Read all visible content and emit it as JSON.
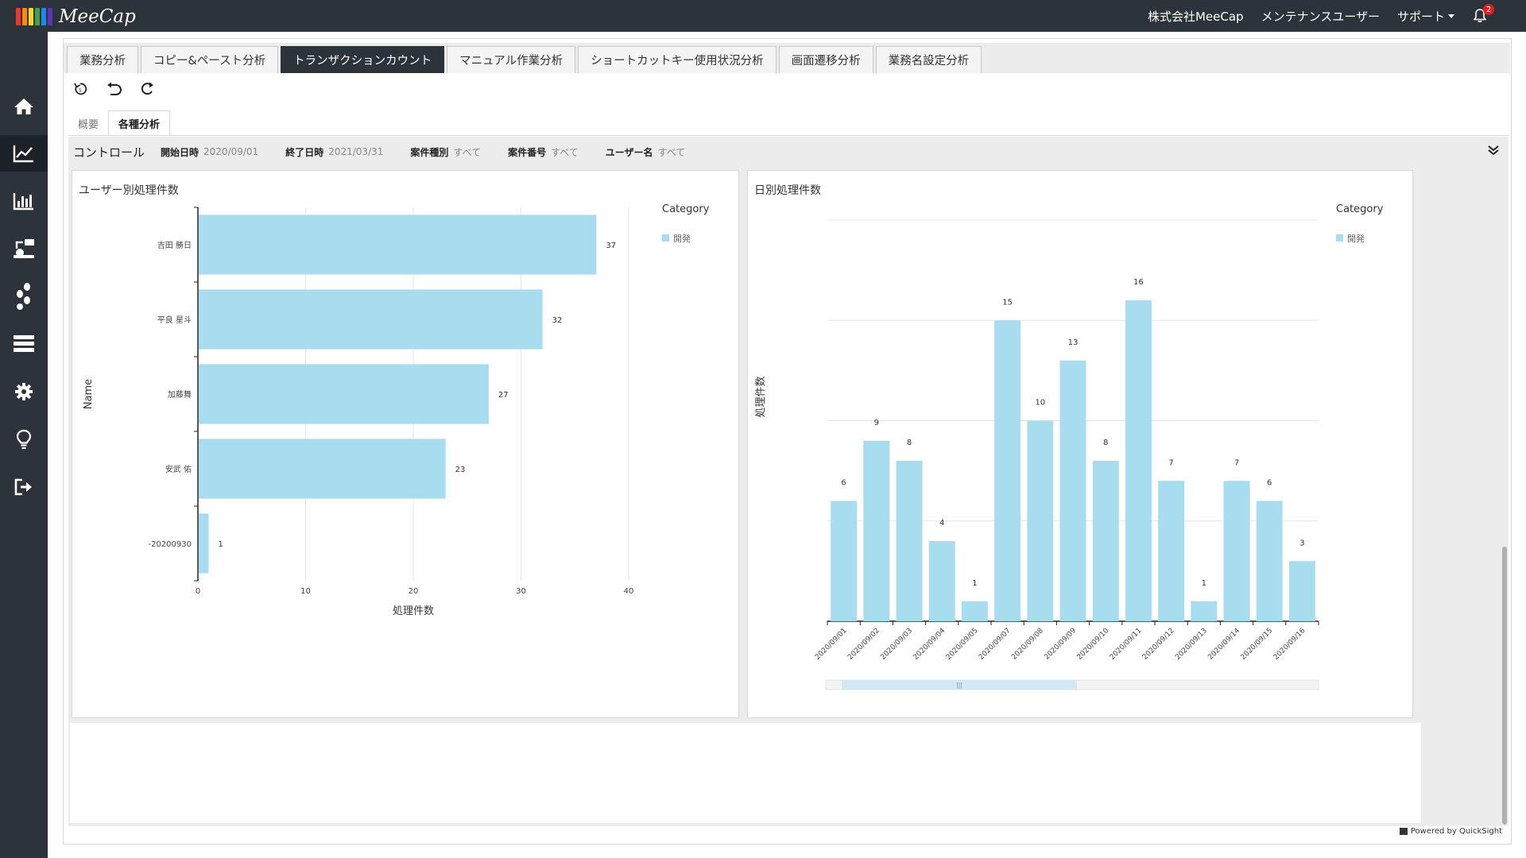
{
  "app": {
    "logo_text": "MeeCap",
    "logo_colors": [
      "#e53935",
      "#fb8c00",
      "#fdd835",
      "#43a047",
      "#1e88e5",
      "#5e35b1"
    ]
  },
  "topbar": {
    "company": "株式会社MeeCap",
    "user": "メンテナンスユーザー",
    "support": "サポート",
    "notification_count": "2"
  },
  "sidebar": {
    "items": [
      {
        "icon": "home-icon"
      },
      {
        "icon": "line-chart-icon",
        "active": true
      },
      {
        "icon": "bar-chart-icon"
      },
      {
        "icon": "workflow-icon"
      },
      {
        "icon": "footsteps-icon"
      },
      {
        "icon": "server-icon"
      },
      {
        "icon": "gear-icon"
      },
      {
        "icon": "lightbulb-icon"
      },
      {
        "icon": "logout-icon"
      }
    ]
  },
  "tabs": [
    {
      "label": "業務分析"
    },
    {
      "label": "コピー&ペースト分析"
    },
    {
      "label": "トランザクションカウント",
      "active": true
    },
    {
      "label": "マニュアル作業分析"
    },
    {
      "label": "ショートカットキー使用状況分析"
    },
    {
      "label": "画面遷移分析"
    },
    {
      "label": "業務名設定分析"
    }
  ],
  "subtabs": [
    {
      "label": "概要"
    },
    {
      "label": "各種分析",
      "active": true
    }
  ],
  "controls": {
    "title": "コントロール",
    "start_label": "開始日時",
    "start_value": "2020/09/01",
    "end_label": "終了日時",
    "end_value": "2021/03/31",
    "type_label": "案件種別",
    "type_value": "すべて",
    "number_label": "案件番号",
    "number_value": "すべて",
    "user_label": "ユーザー名",
    "user_value": "すべて"
  },
  "footer": {
    "powered": "Powered by QuickSight"
  },
  "colors": {
    "bar": "#a8ddf0",
    "dark": "#2c333b"
  },
  "chart_data": [
    {
      "type": "bar",
      "orientation": "horizontal",
      "title": "ユーザー別処理件数",
      "categories": [
        "吉田 勝日",
        "平良 星斗",
        "加藤舞",
        "安武 佑",
        "-20200930"
      ],
      "values": [
        37,
        32,
        27,
        23,
        1
      ],
      "xlabel": "処理件数",
      "ylabel": "Name",
      "xlim": [
        0,
        40
      ],
      "xticks": [
        "0",
        "10",
        "20",
        "30",
        "40"
      ],
      "legend_title": "Category",
      "legend": [
        "開発"
      ],
      "legend_position": "top-right",
      "grid": true
    },
    {
      "type": "bar",
      "title": "日別処理件数",
      "categories": [
        "2020/09/01",
        "2020/09/02",
        "2020/09/03",
        "2020/09/04",
        "2020/09/05",
        "2020/09/07",
        "2020/09/08",
        "2020/09/09",
        "2020/09/10",
        "2020/09/11",
        "2020/09/12",
        "2020/09/13",
        "2020/09/14",
        "2020/09/15",
        "2020/09/16"
      ],
      "values": [
        6,
        9,
        8,
        4,
        1,
        15,
        10,
        13,
        8,
        16,
        7,
        1,
        7,
        6,
        3
      ],
      "ylabel": "処理件数",
      "ylim": [
        0,
        20
      ],
      "legend_title": "Category",
      "legend": [
        "開発"
      ],
      "legend_position": "top-right",
      "grid": true
    }
  ]
}
